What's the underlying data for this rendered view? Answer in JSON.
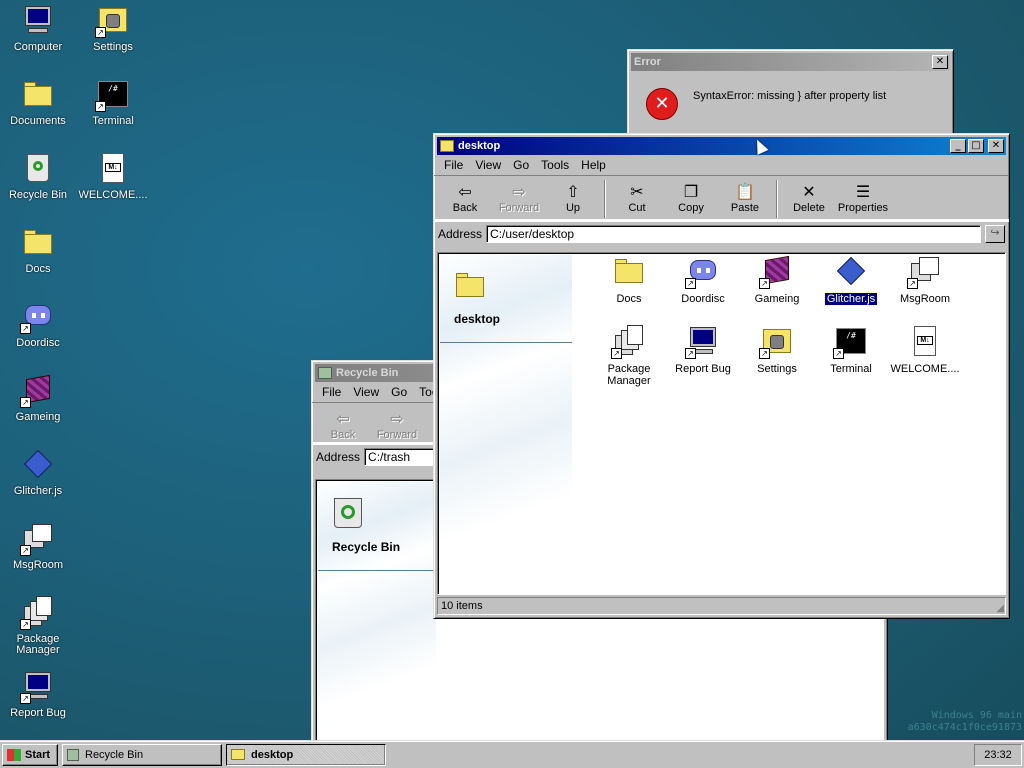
{
  "desktop_icons": [
    {
      "name": "desktop-icon-computer",
      "label": "Computer",
      "icon": "computer-icon"
    },
    {
      "name": "desktop-icon-settings",
      "label": "Settings",
      "icon": "settings-icon"
    },
    {
      "name": "desktop-icon-documents",
      "label": "Documents",
      "icon": "open-folder-icon"
    },
    {
      "name": "desktop-icon-terminal",
      "label": "Terminal",
      "icon": "terminal-icon"
    },
    {
      "name": "desktop-icon-recycle-bin",
      "label": "Recycle Bin",
      "icon": "recycle-bin-icon"
    },
    {
      "name": "desktop-icon-welcome",
      "label": "WELCOME....",
      "icon": "markdown-file-icon"
    },
    {
      "name": "desktop-icon-docs",
      "label": "Docs",
      "icon": "folder-icon"
    },
    {
      "name": "desktop-icon-doordisc",
      "label": "Doordisc",
      "icon": "doordisc-icon"
    },
    {
      "name": "desktop-icon-gameing",
      "label": "Gameing",
      "icon": "cube-icon"
    },
    {
      "name": "desktop-icon-glitcher",
      "label": "Glitcher.js",
      "icon": "diamond-icon"
    },
    {
      "name": "desktop-icon-msgroom",
      "label": "MsgRoom",
      "icon": "msgroom-icon"
    },
    {
      "name": "desktop-icon-package-manager",
      "label": "Package\nManager",
      "icon": "package-icon"
    },
    {
      "name": "desktop-icon-report-bug",
      "label": "Report Bug",
      "icon": "monitor-icon"
    }
  ],
  "error_window": {
    "title": "Error",
    "message": "SyntaxError: missing } after property list",
    "close": "✕"
  },
  "desktop_window": {
    "title": "desktop",
    "menu": [
      "File",
      "View",
      "Go",
      "Tools",
      "Help"
    ],
    "toolbar": [
      {
        "label": "Back",
        "glyph": "⇦",
        "disabled": false
      },
      {
        "label": "Forward",
        "glyph": "⇨",
        "disabled": true
      },
      {
        "label": "Up",
        "glyph": "⇧",
        "disabled": false
      },
      {
        "label": "Cut",
        "glyph": "✂",
        "disabled": false
      },
      {
        "label": "Copy",
        "glyph": "❐",
        "disabled": false
      },
      {
        "label": "Paste",
        "glyph": "📋",
        "disabled": false
      },
      {
        "label": "Delete",
        "glyph": "✕",
        "disabled": false
      },
      {
        "label": "Properties",
        "glyph": "☰",
        "disabled": false
      }
    ],
    "address_label": "Address",
    "address_value": "C:/user/desktop",
    "go_glyph": "↪",
    "side_title": "desktop",
    "files": [
      {
        "label": "Docs",
        "icon": "folder-icon"
      },
      {
        "label": "Doordisc",
        "icon": "doordisc-icon"
      },
      {
        "label": "Gameing",
        "icon": "cube-icon"
      },
      {
        "label": "Glitcher.js",
        "icon": "diamond-icon"
      },
      {
        "label": "MsgRoom",
        "icon": "msgroom-icon"
      },
      {
        "label": "Package Manager",
        "icon": "package-icon"
      },
      {
        "label": "Report Bug",
        "icon": "monitor-icon"
      },
      {
        "label": "Settings",
        "icon": "settings-icon"
      },
      {
        "label": "Terminal",
        "icon": "terminal-icon"
      },
      {
        "label": "WELCOME....",
        "icon": "markdown-file-icon"
      }
    ],
    "selected_file": "Glitcher.js",
    "status": "10 items"
  },
  "recycle_window": {
    "title": "Recycle Bin",
    "menu": [
      "File",
      "View",
      "Go",
      "Tools"
    ],
    "toolbar": [
      {
        "label": "Back",
        "glyph": "⇦"
      },
      {
        "label": "Forward",
        "glyph": "⇨"
      }
    ],
    "address_label": "Address",
    "address_value": "C:/trash",
    "side_title": "Recycle Bin"
  },
  "taskbar": {
    "start": "Start",
    "tasks": [
      "Recycle Bin",
      "desktop"
    ],
    "active_task": "desktop",
    "clock": "23:32"
  },
  "watermark": [
    "Windows 96 main",
    "a630c474c1f0ce91873"
  ],
  "colors": {
    "desktop": "#1d6079",
    "titlebar_active": "#000080",
    "titlebar_inactive": "#808080",
    "selection": "#000080",
    "error_red": "#e01c1c"
  }
}
